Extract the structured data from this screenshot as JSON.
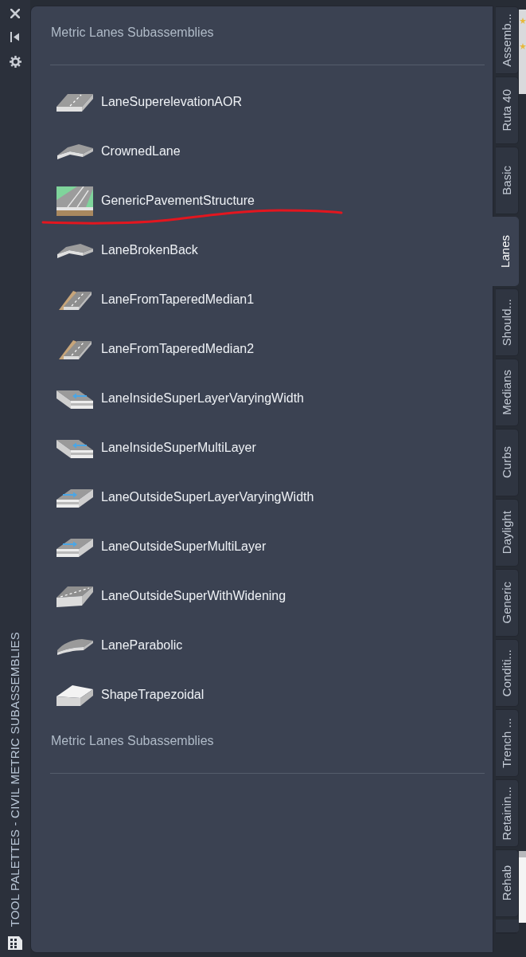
{
  "sidebar": {
    "title": "TOOL PALETTES - CIVIL METRIC SUBASSEMBLIES"
  },
  "palette": {
    "header": "Metric Lanes Subassemblies",
    "items": [
      {
        "label": "LaneSuperelevationAOR",
        "kind": "flat",
        "marked": false
      },
      {
        "label": "CrownedLane",
        "kind": "crowned",
        "marked": false
      },
      {
        "label": "GenericPavementStructure",
        "kind": "pavement",
        "marked": true
      },
      {
        "label": "LaneBrokenBack",
        "kind": "brokenback",
        "marked": false
      },
      {
        "label": "LaneFromTaperedMedian1",
        "kind": "median",
        "marked": false
      },
      {
        "label": "LaneFromTaperedMedian2",
        "kind": "median",
        "marked": false
      },
      {
        "label": "LaneInsideSuperLayerVaryingWidth",
        "kind": "inside",
        "marked": false
      },
      {
        "label": "LaneInsideSuperMultiLayer",
        "kind": "inside",
        "marked": false
      },
      {
        "label": "LaneOutsideSuperLayerVaryingWidth",
        "kind": "outside",
        "marked": false
      },
      {
        "label": "LaneOutsideSuperMultiLayer",
        "kind": "outside",
        "marked": false
      },
      {
        "label": "LaneOutsideSuperWithWidening",
        "kind": "widening",
        "marked": false
      },
      {
        "label": "LaneParabolic",
        "kind": "parabolic",
        "marked": false
      },
      {
        "label": "ShapeTrapezoidal",
        "kind": "trapezoid",
        "marked": false
      }
    ],
    "footer": "Metric Lanes Subassemblies"
  },
  "tabs": [
    {
      "label": "Assemb...",
      "selected": false
    },
    {
      "label": "Ruta 40",
      "selected": false
    },
    {
      "label": "Basic",
      "selected": false
    },
    {
      "label": "Lanes",
      "selected": true
    },
    {
      "label": "Should...",
      "selected": false
    },
    {
      "label": "Medians",
      "selected": false
    },
    {
      "label": "Curbs",
      "selected": false
    },
    {
      "label": "Daylight",
      "selected": false
    },
    {
      "label": "Generic",
      "selected": false
    },
    {
      "label": "Conditi...",
      "selected": false
    },
    {
      "label": "Trench ...",
      "selected": false
    },
    {
      "label": "Retainin...",
      "selected": false
    },
    {
      "label": "Rehab",
      "selected": false
    }
  ]
}
